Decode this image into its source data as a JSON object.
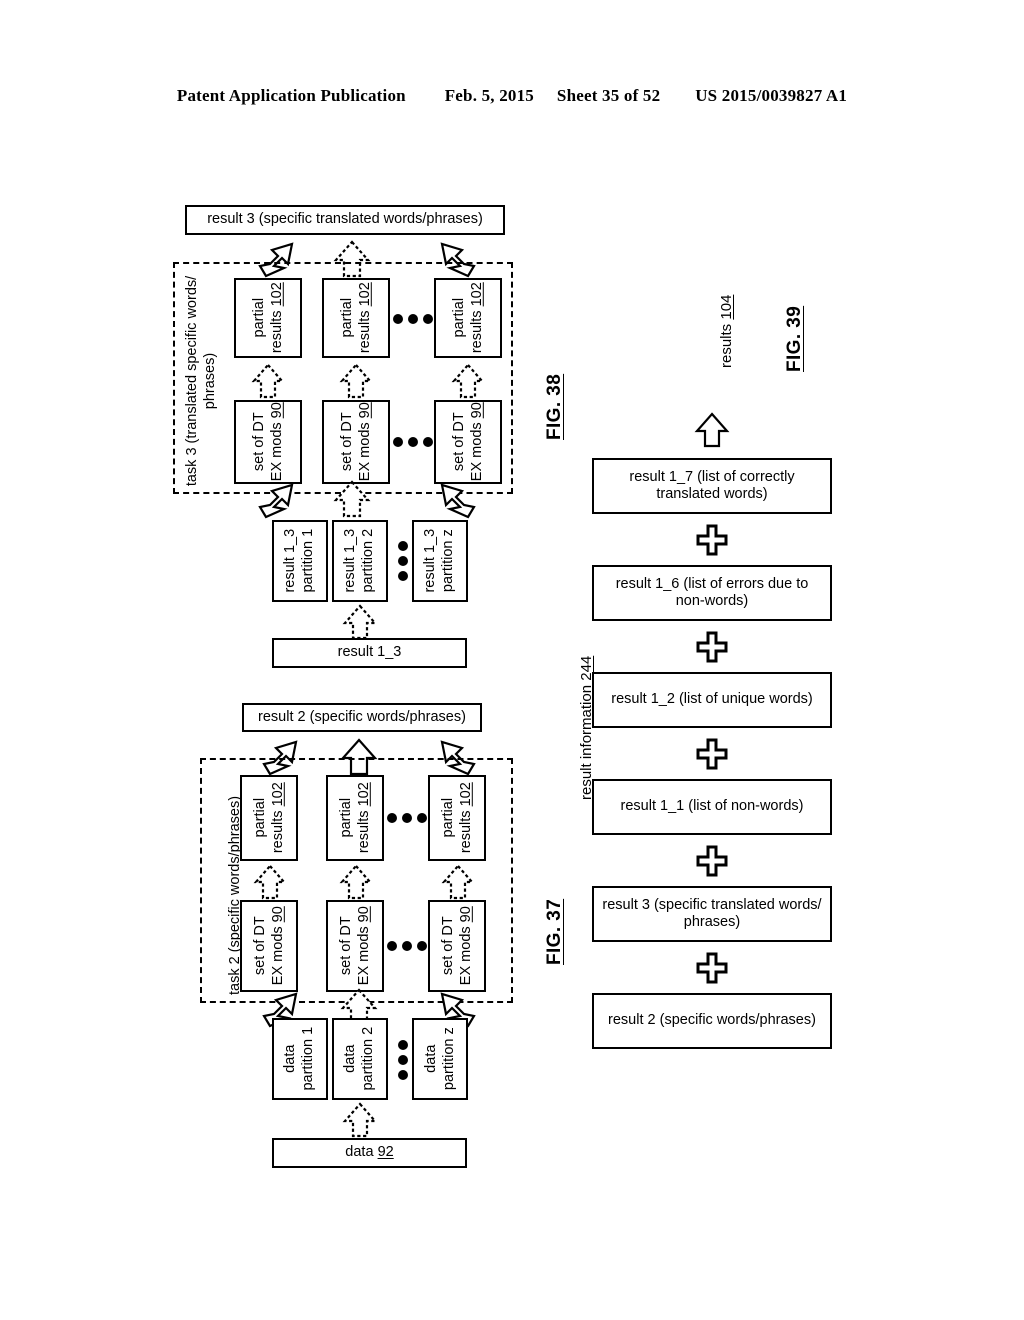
{
  "header": {
    "publication": "Patent Application Publication",
    "date": "Feb. 5, 2015",
    "sheet": "Sheet 35 of 52",
    "number": "US 2015/0039827 A1"
  },
  "fig38": {
    "label": "FIG. 38",
    "output_box": "result  3 (specific translated words/phrases)",
    "task_label_line1": "task 3 (translated specific words/",
    "task_label_line2": "phrases)",
    "partial_results": [
      {
        "line1": "partial",
        "line2": "results",
        "ref": "102"
      },
      {
        "line1": "partial",
        "line2": "results",
        "ref": "102"
      },
      {
        "line1": "partial",
        "line2": "results",
        "ref": "102"
      }
    ],
    "dt_ex_mods": [
      {
        "line1": "set of DT",
        "line2": "EX mods",
        "ref": "90"
      },
      {
        "line1": "set of DT",
        "line2": "EX mods",
        "ref": "90"
      },
      {
        "line1": "set of DT",
        "line2": "EX mods",
        "ref": "90"
      }
    ],
    "partitions": [
      {
        "line1": "result 1_3",
        "line2": "partition 1"
      },
      {
        "line1": "result 1_3",
        "line2": "partition 2"
      },
      {
        "line1": "result 1_3",
        "line2": "partition z"
      }
    ],
    "source_box": "result 1_3"
  },
  "fig37": {
    "label": "FIG. 37",
    "output_box": "result  2 (specific words/phrases)",
    "task_label": "task 2 (specific words/phrases)",
    "partial_results": [
      {
        "line1": "partial",
        "line2": "results",
        "ref": "102"
      },
      {
        "line1": "partial",
        "line2": "results",
        "ref": "102"
      },
      {
        "line1": "partial",
        "line2": "results",
        "ref": "102"
      }
    ],
    "dt_ex_mods": [
      {
        "line1": "set of DT",
        "line2": "EX mods",
        "ref": "90"
      },
      {
        "line1": "set of DT",
        "line2": "EX mods",
        "ref": "90"
      },
      {
        "line1": "set of DT",
        "line2": "EX mods",
        "ref": "90"
      }
    ],
    "partitions": [
      {
        "line1": "data",
        "line2": "partition 1"
      },
      {
        "line1": "data",
        "line2": "partition 2"
      },
      {
        "line1": "data",
        "line2": "partition z"
      }
    ],
    "source_box_text": "data",
    "source_box_ref": "92"
  },
  "fig39": {
    "label": "FIG. 39",
    "results_label_text": "results",
    "results_label_ref": "104",
    "side_label_text": "result information",
    "side_label_ref": "244",
    "stack": [
      "result 1_7 (list of correctly translated words)",
      "result 1_6 (list of errors due to non-words)",
      "result 1_2 (list of unique words)",
      "result 1_1 (list of non-words)",
      "result  3 (specific translated words/ phrases)",
      "result  2 (specific words/phrases)"
    ],
    "stack_lines": [
      {
        "l1": "result 1_7 (list of correctly",
        "l2": "translated words)"
      },
      {
        "l1": "result 1_6 (list of errors due to",
        "l2": "non-words)"
      },
      {
        "l1": "result 1_2 (list of unique words)",
        "l2": ""
      },
      {
        "l1": "result 1_1 (list of non-words)",
        "l2": ""
      },
      {
        "l1": "result  3 (specific translated words/",
        "l2": "phrases)"
      },
      {
        "l1": "result  2 (specific words/phrases)",
        "l2": ""
      }
    ],
    "operator": "plus-sign"
  },
  "colors": {
    "ink": "#000000",
    "paper": "#ffffff"
  }
}
